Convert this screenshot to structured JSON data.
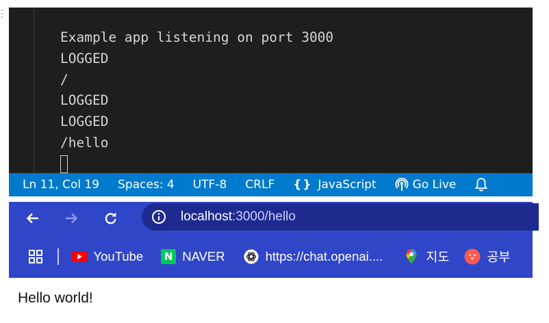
{
  "terminal": {
    "lines": [
      "Example app listening on port 3000",
      "LOGGED",
      "/",
      "LOGGED",
      "LOGGED",
      "/hello"
    ]
  },
  "statusbar": {
    "position": "Ln 11, Col 19",
    "spaces": "Spaces: 4",
    "encoding": "UTF-8",
    "eol": "CRLF",
    "language_braces": "{}",
    "language": "JavaScript",
    "golive": "Go Live",
    "colors": {
      "background": "#007acc"
    }
  },
  "browser": {
    "url_host": "localhost",
    "url_rest": ":3000/hello",
    "bookmarks": [
      {
        "label": "YouTube",
        "icon": "youtube-icon"
      },
      {
        "label": "NAVER",
        "icon": "naver-icon",
        "glyph": "N"
      },
      {
        "label": "https://chat.openai....",
        "icon": "openai-icon"
      },
      {
        "label": "지도",
        "icon": "maps-pin-icon"
      },
      {
        "label": "공부",
        "icon": "study-icon"
      }
    ],
    "colors": {
      "frame": "#3046c9",
      "omnibox": "#1f2a8f"
    }
  },
  "page": {
    "body_text": "Hello world!"
  }
}
